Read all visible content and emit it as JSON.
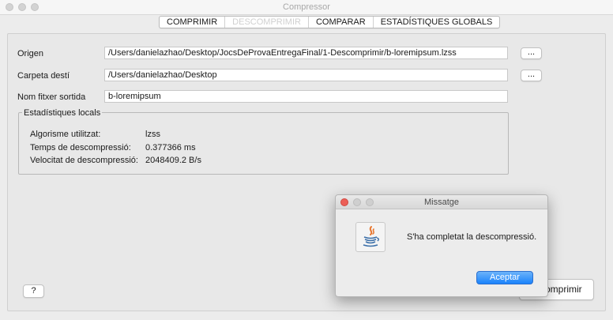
{
  "window": {
    "title": "Compressor"
  },
  "tabs": [
    {
      "label": "COMPRIMIR"
    },
    {
      "label": "DESCOMPRIMIR"
    },
    {
      "label": "COMPARAR"
    },
    {
      "label": "ESTADÍSTIQUES GLOBALS"
    }
  ],
  "form": {
    "origen_label": "Origen",
    "origen_value": "/Users/danielazhao/Desktop/JocsDeProvaEntregaFinal/1-Descomprimir/b-loremipsum.lzss",
    "carpeta_label": "Carpeta destí",
    "carpeta_value": "/Users/danielazhao/Desktop",
    "nom_label": "Nom fitxer sortida",
    "nom_value": "b-loremipsum",
    "browse_label": "..."
  },
  "stats": {
    "title": "Estadístiques locals",
    "algorisme_label": "Algorisme utilitzat:",
    "algorisme_value": "lzss",
    "temps_label": "Temps de descompressió:",
    "temps_value": "0.377366 ms",
    "velocitat_label": "Velocitat de descompressió:",
    "velocitat_value": "2048409.2 B/s"
  },
  "footer": {
    "help_label": "?",
    "action_label_visible": "omprimir"
  },
  "dialog": {
    "title": "Missatge",
    "message": "S'ha completat la descompressió.",
    "ok_label": "Aceptar"
  },
  "colors": {
    "accent": "#1a82fb",
    "close_dot": "#ec5f57",
    "inactive_dot": "#cfcfcf"
  }
}
